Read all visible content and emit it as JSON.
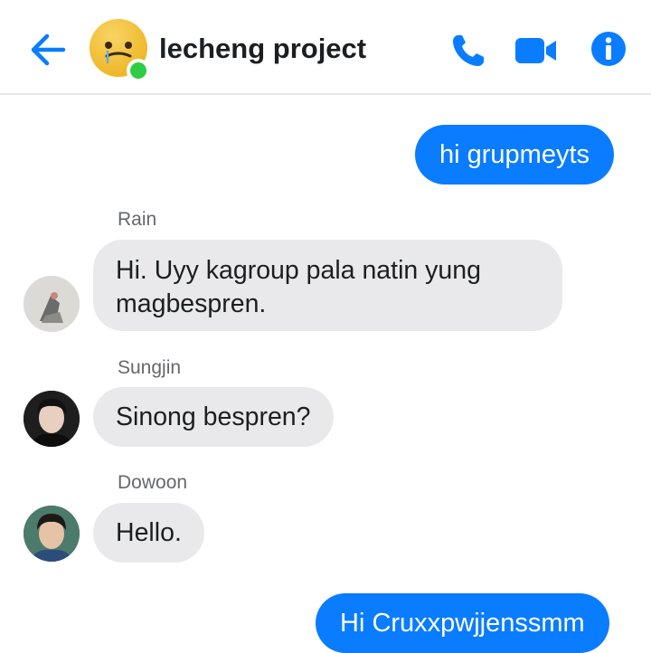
{
  "header": {
    "title": "lecheng project",
    "back_icon": "arrow-left-icon",
    "call_icon": "phone-icon",
    "video_icon": "video-camera-icon",
    "info_icon": "info-icon",
    "accent_color": "#0a7cff",
    "online_color": "#31cc46"
  },
  "messages": [
    {
      "direction": "outgoing",
      "text": "hi grupmeyts"
    },
    {
      "direction": "incoming",
      "sender": "Rain",
      "text": "Hi. Uyy kagroup pala natin yung magbespren."
    },
    {
      "direction": "incoming",
      "sender": "Sungjin",
      "text": "Sinong bespren?"
    },
    {
      "direction": "incoming",
      "sender": "Dowoon",
      "text": "Hello."
    },
    {
      "direction": "outgoing",
      "text": "Hi Cruxxpwjjenssmm"
    }
  ]
}
